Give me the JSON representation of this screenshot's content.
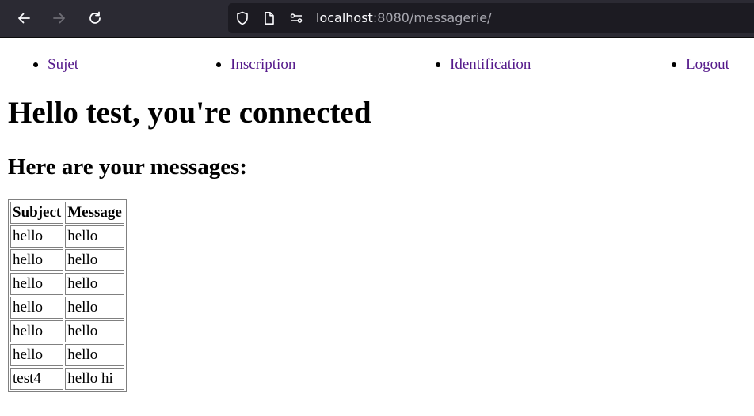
{
  "browser": {
    "back_icon": "arrow-left-icon",
    "forward_icon": "arrow-right-icon",
    "reload_icon": "reload-icon",
    "url_host": "localhost",
    "url_rest": ":8080/messagerie/"
  },
  "nav": {
    "items": [
      {
        "label": "Sujet"
      },
      {
        "label": "Inscription"
      },
      {
        "label": "Identification"
      },
      {
        "label": "Logout"
      }
    ]
  },
  "main": {
    "title": "Hello test, you're connected",
    "subtitle": "Here are your messages:"
  },
  "table": {
    "headers": [
      "Subject",
      "Message"
    ],
    "rows": [
      [
        "hello",
        "hello"
      ],
      [
        "hello",
        "hello"
      ],
      [
        "hello",
        "hello"
      ],
      [
        "hello",
        "hello"
      ],
      [
        "hello",
        "hello"
      ],
      [
        "hello",
        "hello"
      ],
      [
        "test4",
        "hello hi"
      ]
    ]
  }
}
